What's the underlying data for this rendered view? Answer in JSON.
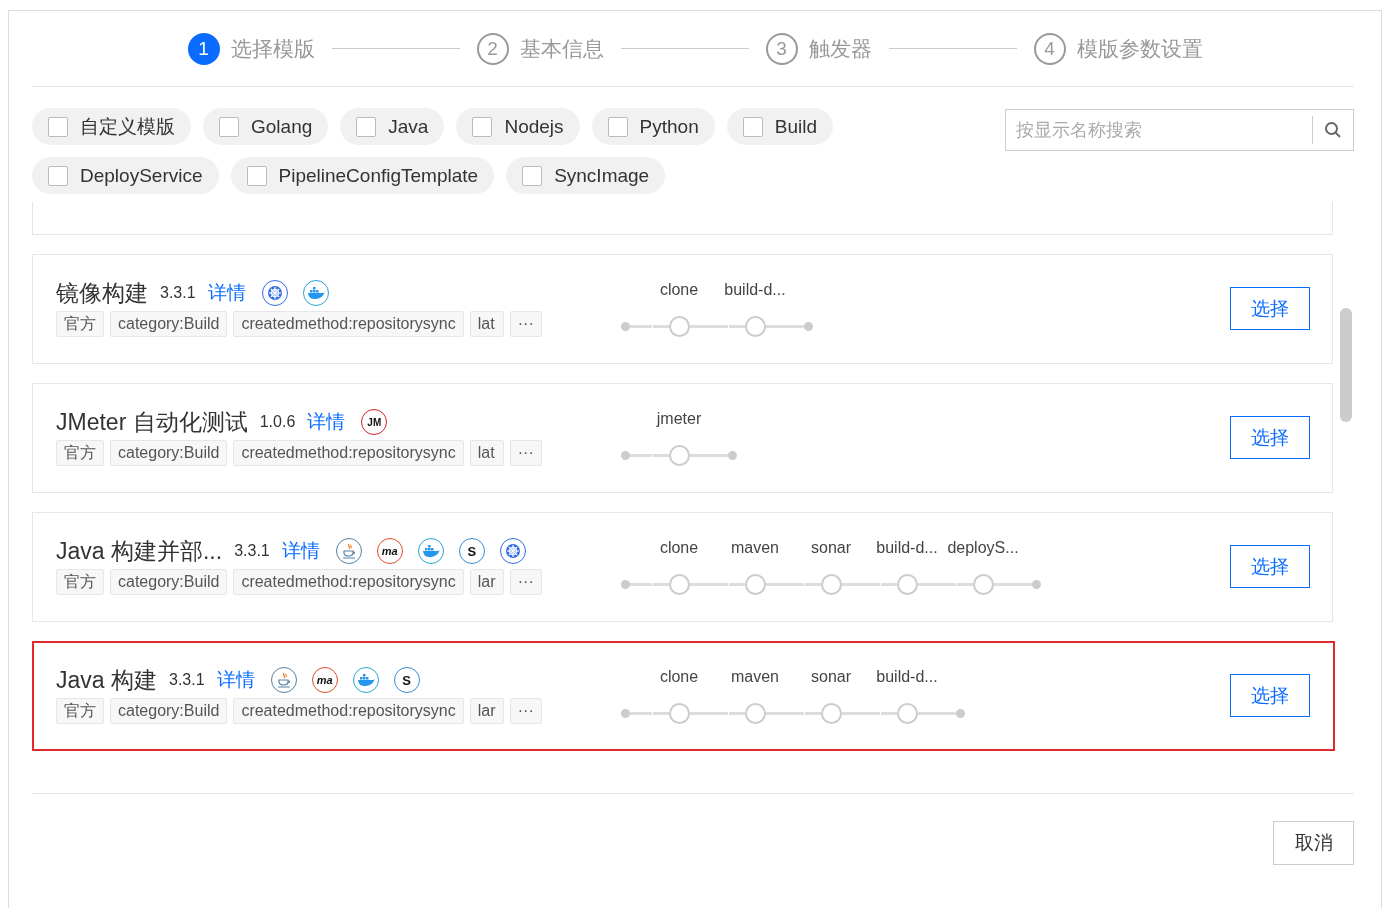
{
  "steps": [
    {
      "number": "1",
      "label": "选择模版",
      "selected": true
    },
    {
      "number": "2",
      "label": "基本信息",
      "selected": false
    },
    {
      "number": "3",
      "label": "触发器",
      "selected": false
    },
    {
      "number": "4",
      "label": "模版参数设置",
      "selected": false
    }
  ],
  "filters": [
    {
      "label": "自定义模版",
      "checked": false
    },
    {
      "label": "Golang",
      "checked": false
    },
    {
      "label": "Java",
      "checked": false
    },
    {
      "label": "Nodejs",
      "checked": false
    },
    {
      "label": "Python",
      "checked": false
    },
    {
      "label": "Build",
      "checked": false
    },
    {
      "label": "DeployService",
      "checked": false
    },
    {
      "label": "PipelineConfigTemplate",
      "checked": false
    },
    {
      "label": "SyncImage",
      "checked": false
    }
  ],
  "search": {
    "placeholder": "按显示名称搜索"
  },
  "templates": [
    {
      "kind": "partial",
      "selected": false
    },
    {
      "kind": "full",
      "selected": false,
      "name": "镜像构建",
      "version": "3.3.1",
      "details": "详情",
      "icons": [
        {
          "kind": "helm"
        },
        {
          "kind": "docker"
        }
      ],
      "tags": [
        "官方",
        "category:Build",
        "createdmethod:repositorysync",
        "lat",
        "···"
      ],
      "stages": [
        {
          "label": "clone"
        },
        {
          "label": "build-d..."
        }
      ],
      "action": "选择"
    },
    {
      "kind": "full",
      "selected": false,
      "name": "JMeter 自动化测试",
      "version": "1.0.6",
      "details": "详情",
      "icons": [
        {
          "kind": "jmeter",
          "label": "JM"
        }
      ],
      "tags": [
        "官方",
        "category:Build",
        "createdmethod:repositorysync",
        "lat",
        "···"
      ],
      "stages": [
        {
          "label": "jmeter"
        }
      ],
      "action": "选择"
    },
    {
      "kind": "full",
      "selected": false,
      "name": "Java 构建并部...",
      "version": "3.3.1",
      "details": "详情",
      "icons": [
        {
          "kind": "java"
        },
        {
          "kind": "maven",
          "label": "ma"
        },
        {
          "kind": "docker"
        },
        {
          "kind": "sonar",
          "label": "S"
        },
        {
          "kind": "helm"
        }
      ],
      "tags": [
        "官方",
        "category:Build",
        "createdmethod:repositorysync",
        "lar",
        "···"
      ],
      "stages": [
        {
          "label": "clone"
        },
        {
          "label": "maven"
        },
        {
          "label": "sonar"
        },
        {
          "label": "build-d..."
        },
        {
          "label": "deployS..."
        }
      ],
      "action": "选择"
    },
    {
      "kind": "full",
      "selected": true,
      "name": "Java 构建",
      "version": "3.3.1",
      "details": "详情",
      "icons": [
        {
          "kind": "java"
        },
        {
          "kind": "maven",
          "label": "ma"
        },
        {
          "kind": "docker"
        },
        {
          "kind": "sonar",
          "label": "S"
        }
      ],
      "tags": [
        "官方",
        "category:Build",
        "createdmethod:repositorysync",
        "lar",
        "···"
      ],
      "stages": [
        {
          "label": "clone"
        },
        {
          "label": "maven"
        },
        {
          "label": "sonar"
        },
        {
          "label": "build-d..."
        }
      ],
      "action": "选择"
    }
  ],
  "cancel": "取消"
}
